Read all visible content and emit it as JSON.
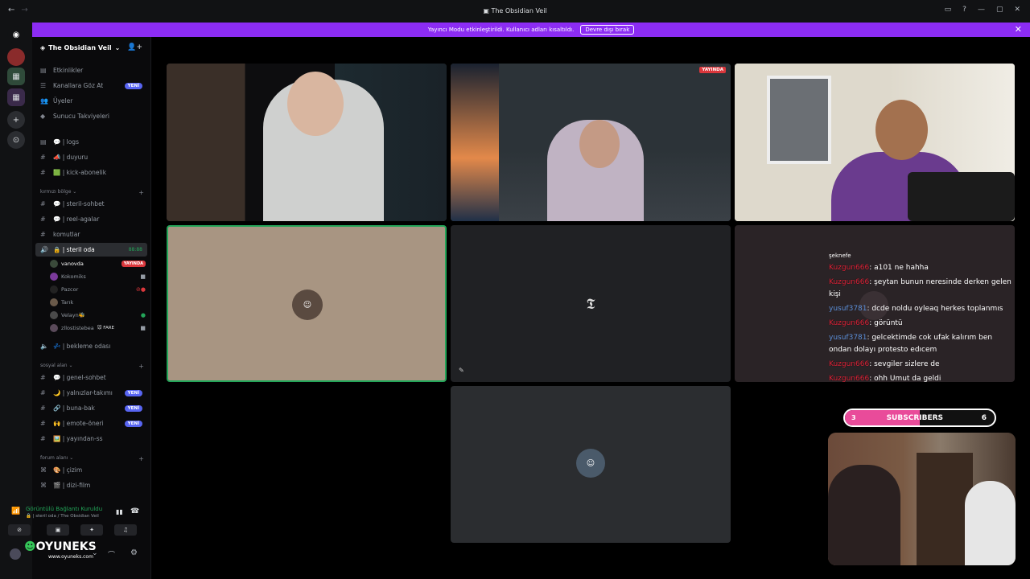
{
  "window": {
    "title": "The Obsidian Veil"
  },
  "banner": {
    "text": "Yayıncı Modu etkinleştirildi. Kullanıcı adları kısaltıldı.",
    "button": "Devre dışı bırak"
  },
  "server": {
    "name": "The Obsidian Veil"
  },
  "nav_items": [
    {
      "label": "Etkinlikler",
      "icon": "calendar-icon"
    },
    {
      "label": "Kanallara Göz At",
      "icon": "browse-icon",
      "badge": "YENİ"
    },
    {
      "label": "Üyeler",
      "icon": "members-icon"
    },
    {
      "label": "Sunucu Takviyeleri",
      "icon": "boost-icon"
    }
  ],
  "channels_top": [
    {
      "label": "💬 | logs"
    },
    {
      "label": "📣 | duyuru"
    },
    {
      "label": "🟩 | kick-abonelik"
    }
  ],
  "cat_kirmizi": "kırmızı bölge",
  "channels_kirmizi": [
    {
      "label": "💬 | steril-sohbet"
    },
    {
      "label": "💬 | reel-agalar"
    },
    {
      "label": "komutlar"
    }
  ],
  "voice_active": {
    "label": "🔒 | steril oda",
    "timer": "88:88"
  },
  "members": [
    {
      "name": "vanovda",
      "live": "YAYINDA"
    },
    {
      "name": "Kokomiks"
    },
    {
      "name": "Pazcor"
    },
    {
      "name": "Tarık"
    },
    {
      "name": "Velayn🐝"
    },
    {
      "name": "zllostistebea",
      "tag": "FARE"
    }
  ],
  "voice_waiting": {
    "label": "💤 | bekleme odası"
  },
  "cat_sosyal": "sosyal alan",
  "channels_sosyal": [
    {
      "label": "💬 | genel-sohbet",
      "badge": ""
    },
    {
      "label": "🌙 | yalnızlar-takımı",
      "badge": "YENİ"
    },
    {
      "label": "🔗 | buna-bak",
      "badge": "YENİ"
    },
    {
      "label": "🙌 | emote-öneri",
      "badge": "YENİ"
    },
    {
      "label": "🖼️ | yayından-ss",
      "badge": ""
    }
  ],
  "cat_forum": "forum alanı",
  "channels_forum": [
    {
      "label": "🎨 | çizim"
    },
    {
      "label": "🎬 | dizi-film"
    }
  ],
  "voice_panel": {
    "status": "Görüntülü Bağlantı Kuruldu",
    "sub": "🔒 | steril oda / The Obsidian Veil"
  },
  "branding": {
    "name": "OYUNEKS",
    "url": "www.oyuneks.com"
  },
  "stream_tags": {
    "live": "YAYINDA"
  },
  "chat_lines": [
    {
      "user": "",
      "text": "şeknefe",
      "cls": ""
    },
    {
      "user": "Kuzgun666",
      "text": ": a101 ne hahha",
      "cls": "u-red"
    },
    {
      "user": "Kuzgun666",
      "text": ": şeytan bunun neresinde derken gelen kişi",
      "cls": "u-red"
    },
    {
      "user": "yusuf3781",
      "text": ": dcde noldu oyleaq herkes toplanmıs",
      "cls": "u-blue"
    },
    {
      "user": "Kuzgun666",
      "text": ": görüntü",
      "cls": "u-red"
    },
    {
      "user": "yusuf3781",
      "text": ": gelcektimde cok ufak kalırım ben ondan dolayı protesto edıcem",
      "cls": "u-blue"
    },
    {
      "user": "Kuzgun666",
      "text": ": sevgiler sizlere de",
      "cls": "u-red"
    },
    {
      "user": "Kuzgun666",
      "text": ": ohh Umut da geldi",
      "cls": "u-red"
    }
  ],
  "subs": {
    "current": "3",
    "label": "SUBSCRIBERS",
    "goal": "6",
    "progress": 0.5
  },
  "colors": {
    "accent": "#8c2cf4",
    "live": "#da373c",
    "badge": "#5865f2"
  }
}
